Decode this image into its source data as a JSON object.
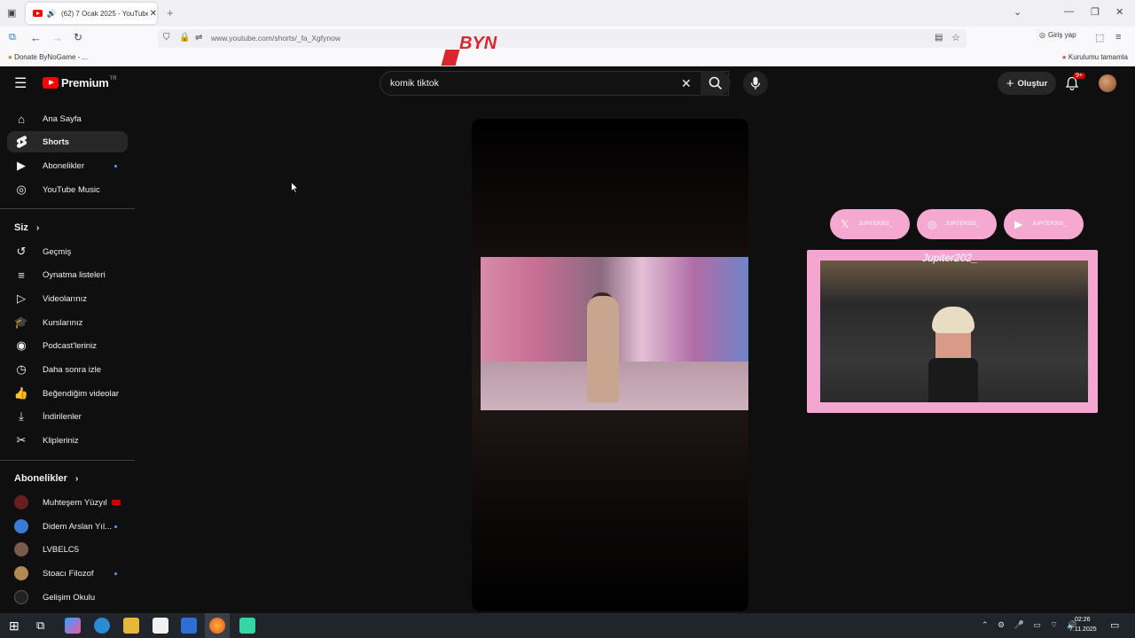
{
  "browser": {
    "tab_title": "(62) 7 Ocak 2025 - YouTube",
    "tab_close": "✕",
    "new_tab": "+",
    "url": "www.youtube.com/shorts/_fa_Xgfynow",
    "signin_label": "Giriş yap",
    "bookmark_left": "Donate ByNoGame - ...",
    "bookmark_right": "Kurulumu tamamla",
    "overlay_logo": "BYN"
  },
  "header": {
    "logo_text": "Premium",
    "logo_region": "TR",
    "search_value": "komik tiktok",
    "create_label": "Oluştur",
    "notif_badge": "9+"
  },
  "sidebar": {
    "main": [
      {
        "label": "Ana Sayfa",
        "icon": "home-icon"
      },
      {
        "label": "Shorts",
        "icon": "shorts-icon"
      },
      {
        "label": "Abonelikler",
        "icon": "subscriptions-icon"
      },
      {
        "label": "YouTube Music",
        "icon": "music-icon"
      }
    ],
    "you_title": "Siz",
    "you": [
      {
        "label": "Geçmiş",
        "icon": "history-icon"
      },
      {
        "label": "Oynatma listeleri",
        "icon": "playlists-icon"
      },
      {
        "label": "Videolarınız",
        "icon": "your-videos-icon"
      },
      {
        "label": "Kurslarınız",
        "icon": "courses-icon"
      },
      {
        "label": "Podcast'leriniz",
        "icon": "podcasts-icon"
      },
      {
        "label": "Daha sonra izle",
        "icon": "watch-later-icon"
      },
      {
        "label": "Beğendiğim videolar",
        "icon": "liked-icon"
      },
      {
        "label": "İndirilenler",
        "icon": "downloads-icon"
      },
      {
        "label": "Klipleriniz",
        "icon": "clips-icon"
      }
    ],
    "subs_title": "Abonelikler",
    "subs": [
      {
        "label": "Muhteşem Yüzyıl",
        "avatar_color": "#6a1f1f",
        "live": true
      },
      {
        "label": "Didem Arslan Yıl...",
        "avatar_color": "#3a7bd5",
        "dot": true
      },
      {
        "label": "LVBELC5",
        "avatar_color": "#7a5a4a"
      },
      {
        "label": "Stoacı Filozof",
        "avatar_color": "#b08a50",
        "dot": true
      },
      {
        "label": "Gelişim Okulu",
        "avatar_color": "#222222"
      }
    ]
  },
  "stream_overlay": {
    "webcam_name": "Jupiter202_",
    "social_handles": [
      "JUPITER202_",
      "JUPITER202_",
      "JUPITER202_"
    ]
  },
  "taskbar": {
    "time": "02:26",
    "date": "7.11.2025"
  },
  "colors": {
    "yt_red": "#ff0000",
    "bg": "#0f0f0f",
    "overlay_pink": "#f3a6cf"
  }
}
